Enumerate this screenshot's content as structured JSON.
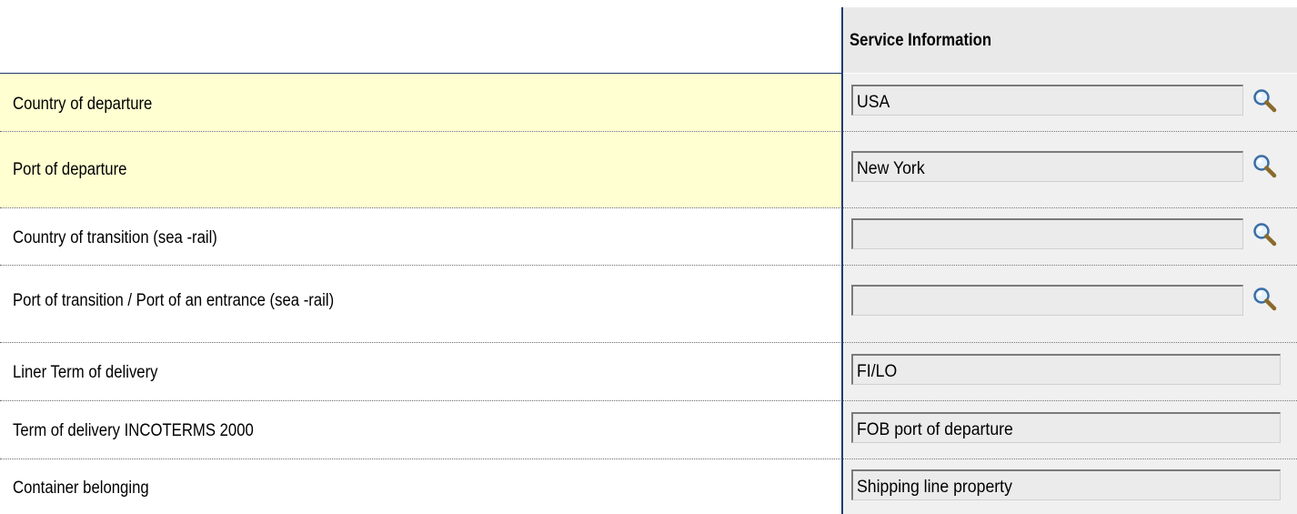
{
  "header": {
    "title": "Service Information"
  },
  "rows": [
    {
      "label": "Country of departure",
      "value": "USA",
      "has_lookup": true,
      "highlighted": true
    },
    {
      "label": "Port of departure",
      "value": "New York",
      "has_lookup": true,
      "highlighted": true
    },
    {
      "label": "Country of transition (sea -rail)",
      "value": "",
      "has_lookup": true,
      "highlighted": false
    },
    {
      "label": "Port of transition / Port of an entrance (sea -rail)",
      "value": "",
      "has_lookup": true,
      "highlighted": false
    },
    {
      "label": "Liner Term of delivery",
      "value": "FI/LO",
      "has_lookup": false,
      "highlighted": false
    },
    {
      "label": "Term of delivery INCOTERMS 2000",
      "value": "FOB port of departure",
      "has_lookup": false,
      "highlighted": false
    },
    {
      "label": "Container belonging",
      "value": "Shipping line property",
      "has_lookup": false,
      "highlighted": false
    }
  ],
  "icons": {
    "lookup": "magnifier-icon"
  },
  "colors": {
    "highlight_row": "#ffffd1",
    "header_bg": "#e9e9e9",
    "divider": "#1f3c6e",
    "field_bg": "#ebebeb"
  }
}
